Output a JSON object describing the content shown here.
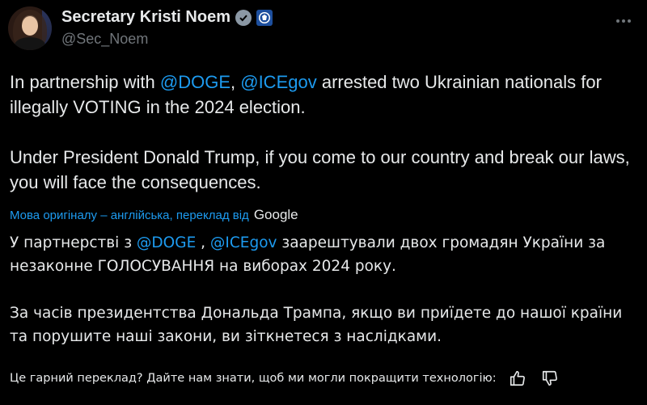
{
  "author": {
    "display_name": "Secretary Kristi Noem",
    "handle": "@Sec_Noem",
    "verified_badge_icon": "verified-badge-icon",
    "affiliate_icon": "dhs-seal-icon"
  },
  "tweet": {
    "p1_before": "In partnership with ",
    "p1_mention1": "@DOGE",
    "p1_sep": ", ",
    "p1_mention2": "@ICEgov",
    "p1_after": " arrested two Ukrainian nationals for illegally VOTING in the 2024 election.",
    "p2": "Under President Donald Trump, if you come to our country and break our laws, you will face the consequences."
  },
  "translation": {
    "note": "Мова оригіналу – англійська, переклад від",
    "provider": "Google",
    "p1_before": "У партнерстві з ",
    "p1_mention1": "@DOGE",
    "p1_sep": " , ",
    "p1_mention2": "@ICEgov",
    "p1_after": " заарештували двох громадян України за незаконне ГОЛОСУВАННЯ на виборах 2024 року.",
    "p2": "За часів президентства Дональда Трампа, якщо ви приїдете до нашої країни та порушите наші закони, ви зіткнетеся з наслідками."
  },
  "feedback": {
    "prompt": "Це гарний переклад? Дайте нам знати, щоб ми могли покращити технологію:",
    "thumbs_up_icon": "thumbs-up-icon",
    "thumbs_down_icon": "thumbs-down-icon"
  },
  "colors": {
    "background": "#000000",
    "text": "#e7e9ea",
    "secondary": "#71767b",
    "link": "#1d9bf0"
  }
}
